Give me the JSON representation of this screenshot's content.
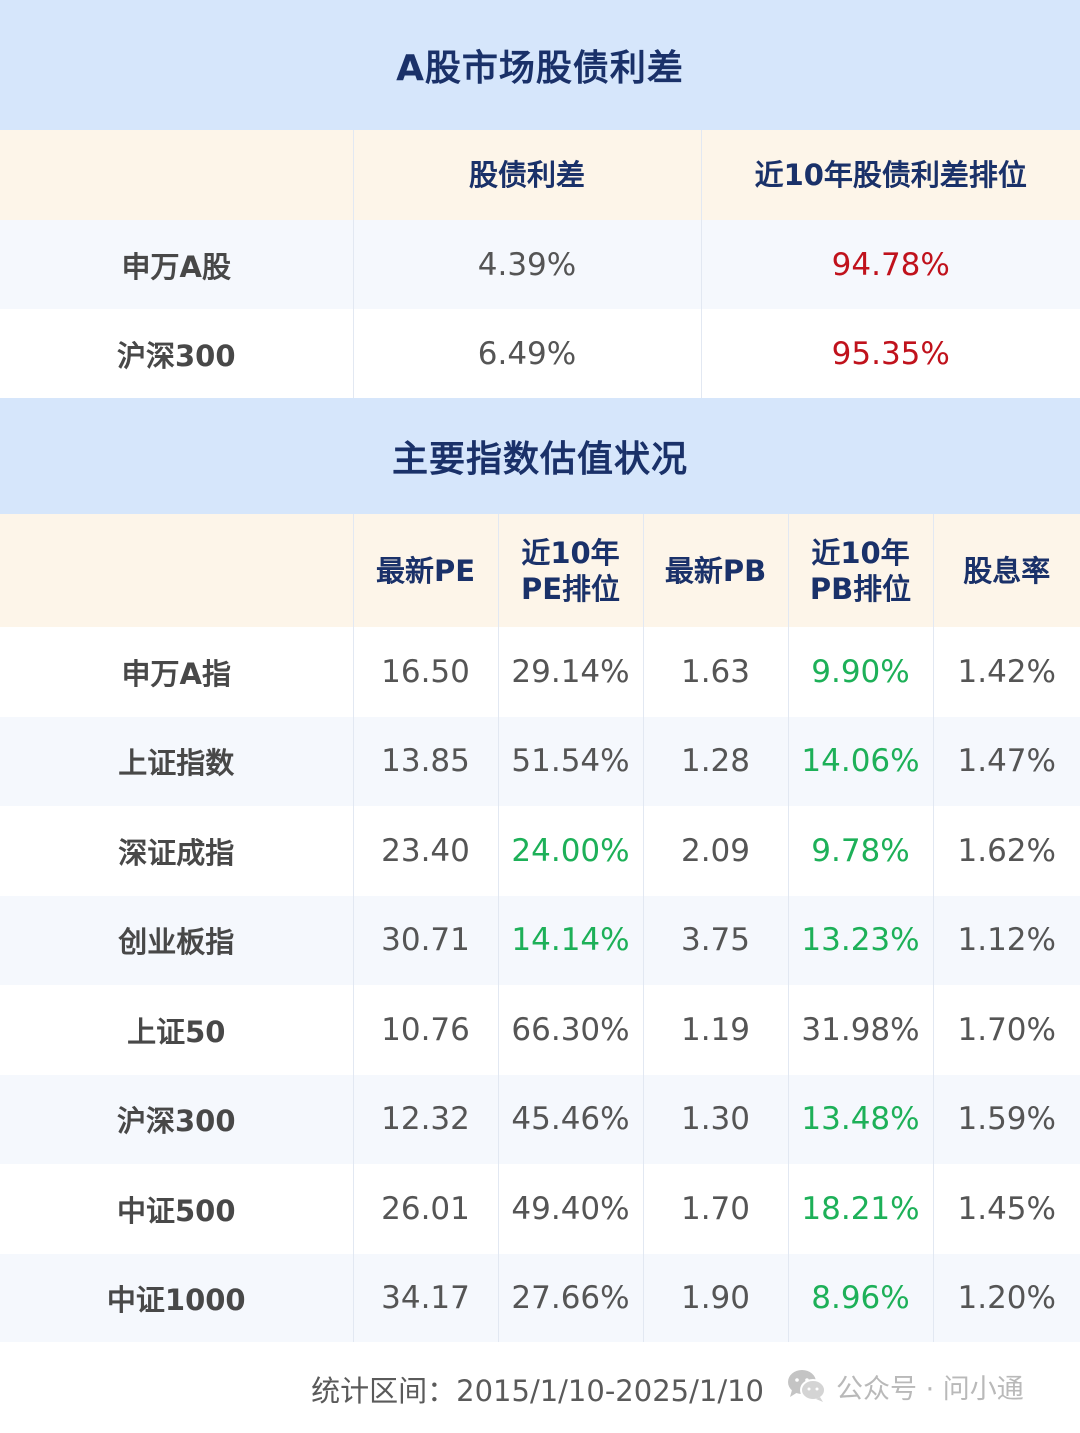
{
  "spread_section": {
    "title": "A股市场股债利差",
    "headers": [
      "",
      "股债利差",
      "近10年股债利差排位"
    ],
    "rows": [
      {
        "label": "申万A股",
        "spread": "4.39%",
        "rank": "94.78%"
      },
      {
        "label": "沪深300",
        "spread": "6.49%",
        "rank": "95.35%"
      }
    ]
  },
  "valuation_section": {
    "title": "主要指数估值状况",
    "headers": [
      "",
      "最新PE",
      "近10年\nPE排位",
      "最新PB",
      "近10年\nPB排位",
      "股息率"
    ],
    "header_lines": {
      "pe_rank": [
        "近10年",
        "PE排位"
      ],
      "pb_rank": [
        "近10年",
        "PB排位"
      ]
    },
    "rows": [
      {
        "label": "申万A指",
        "pe": "16.50",
        "pe_rank": "29.14%",
        "pb": "1.63",
        "pb_rank": "9.90%",
        "yield": "1.42%"
      },
      {
        "label": "上证指数",
        "pe": "13.85",
        "pe_rank": "51.54%",
        "pb": "1.28",
        "pb_rank": "14.06%",
        "yield": "1.47%"
      },
      {
        "label": "深证成指",
        "pe": "23.40",
        "pe_rank": "24.00%",
        "pb": "2.09",
        "pb_rank": "9.78%",
        "yield": "1.62%"
      },
      {
        "label": "创业板指",
        "pe": "30.71",
        "pe_rank": "14.14%",
        "pb": "3.75",
        "pb_rank": "13.23%",
        "yield": "1.12%"
      },
      {
        "label": "上证50",
        "pe": "10.76",
        "pe_rank": "66.30%",
        "pb": "1.19",
        "pb_rank": "31.98%",
        "yield": "1.70%"
      },
      {
        "label": "沪深300",
        "pe": "12.32",
        "pe_rank": "45.46%",
        "pb": "1.30",
        "pb_rank": "13.48%",
        "yield": "1.59%"
      },
      {
        "label": "中证500",
        "pe": "26.01",
        "pe_rank": "49.40%",
        "pb": "1.70",
        "pb_rank": "18.21%",
        "yield": "1.45%"
      },
      {
        "label": "中证1000",
        "pe": "34.17",
        "pe_rank": "27.66%",
        "pb": "1.90",
        "pb_rank": "8.96%",
        "yield": "1.20%"
      }
    ],
    "green_cells": {
      "pe_rank": [
        2,
        3
      ],
      "pb_rank": [
        0,
        1,
        2,
        3,
        5,
        6,
        7
      ]
    }
  },
  "footer": {
    "period": "统计区间：2015/1/10-2025/1/10",
    "watermark": "公众号 · 问小通",
    "watermark_icon": "wechat-icon"
  },
  "colors": {
    "title_bg": "#d6e6fb",
    "title_text": "#1a3169",
    "header_bg": "#fdf5e9",
    "row_alt_bg": "#f5f8fd",
    "red": "#c0121c",
    "green": "#1db058"
  }
}
